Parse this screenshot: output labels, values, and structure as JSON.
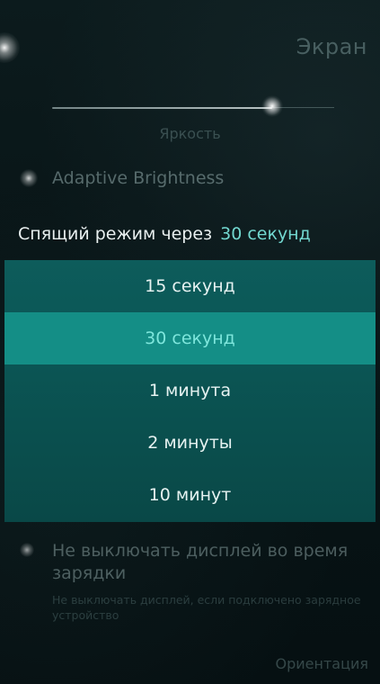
{
  "page": {
    "title": "Экран"
  },
  "brightness": {
    "label": "Яркость",
    "value": 0.78
  },
  "adaptive_brightness": {
    "label": "Adaptive Brightness"
  },
  "sleep_mode": {
    "label": "Спящий режим через",
    "value": "30 секунд",
    "options": [
      "15 секунд",
      "30 секунд",
      "1 минута",
      "2 минуты",
      "10 минут"
    ],
    "selected_index": 1
  },
  "keep_display_on": {
    "title": "Не выключать дисплей во время зарядки",
    "description": "Не выключать дисплей, если подключено зарядное устройство"
  },
  "orientation": {
    "header": "Ориентация"
  },
  "colors": {
    "accent": "#72d8d0",
    "menu_background": "#0b5554",
    "selected_background": "#148e86"
  },
  "icons": {
    "pulley": "pulley-menu-indicator-icon",
    "slider_handle": "slider-handle-icon",
    "switch": "switch-indicator-icon"
  }
}
